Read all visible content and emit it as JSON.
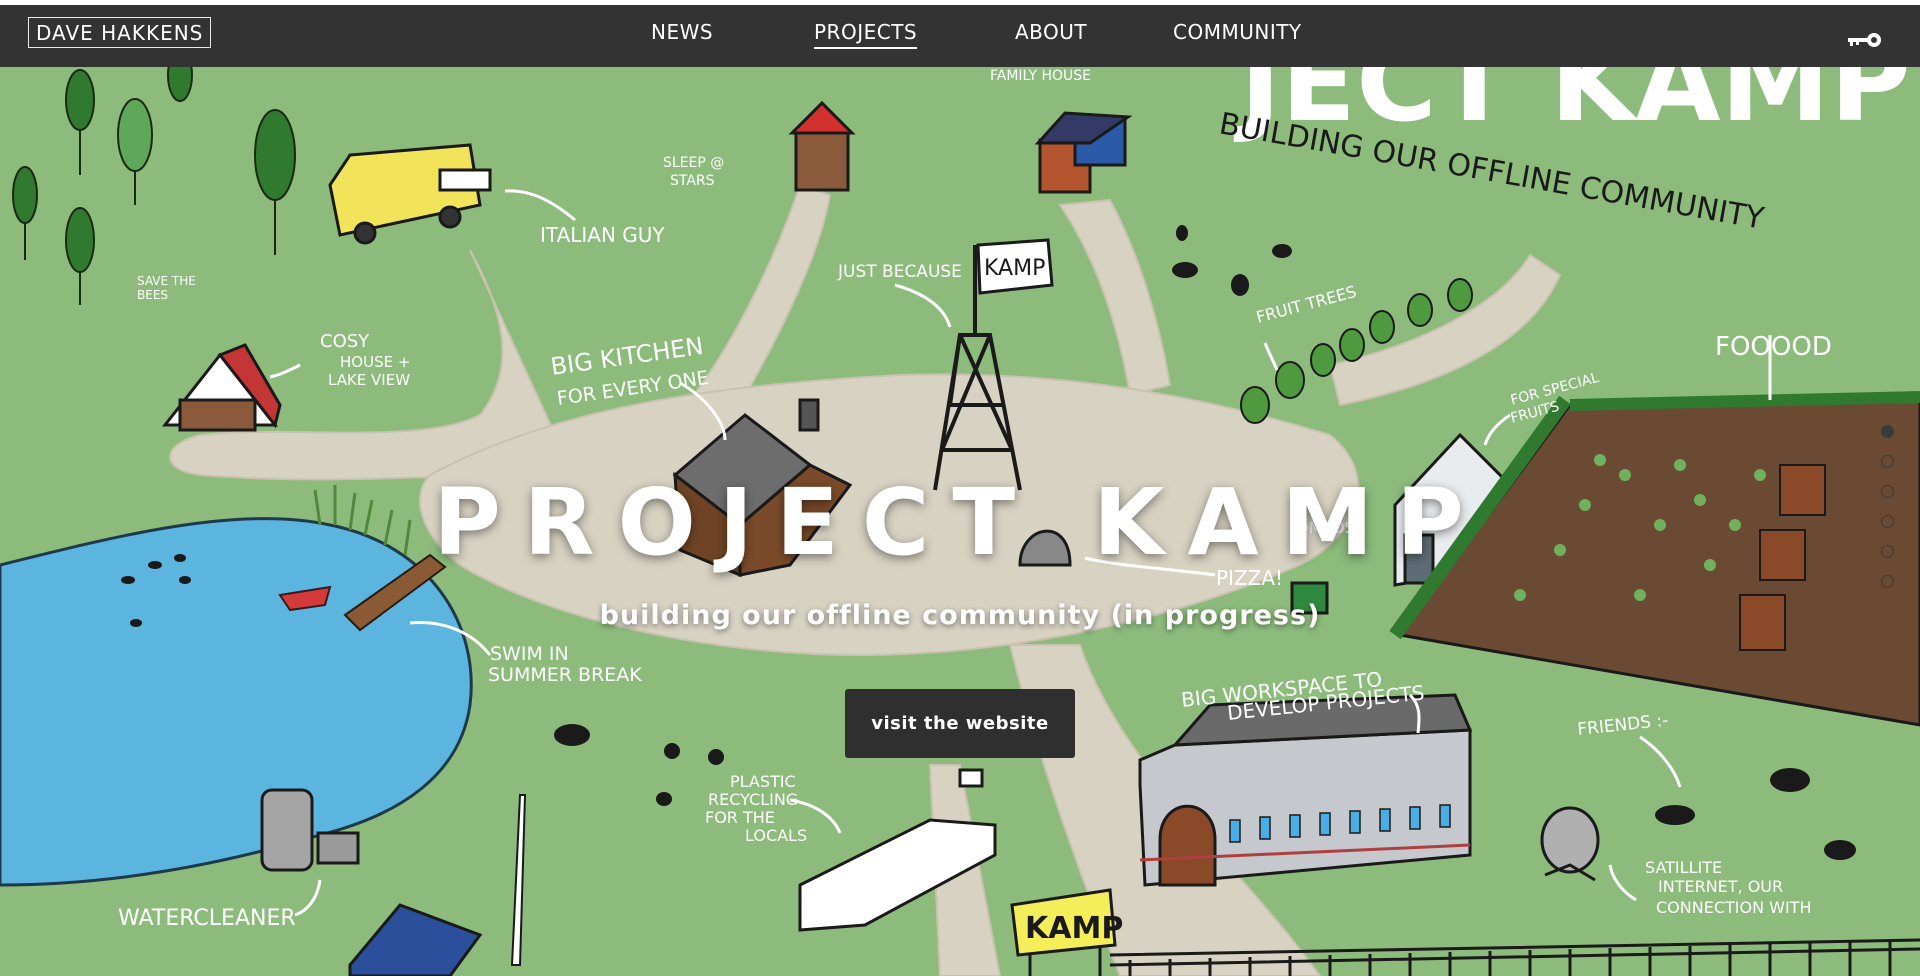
{
  "nav": {
    "logo": "DAVE HAKKENS",
    "links": [
      "NEWS",
      "PROJECTS",
      "ABOUT",
      "COMMUNITY"
    ],
    "active_link": "PROJECTS",
    "login_icon": "key-icon"
  },
  "hero": {
    "title": "PROJECT KAMP",
    "subtitle": "building our offline community (in progress)",
    "button_label": "visit the website",
    "slides_total": 6,
    "active_slide": 1
  },
  "map_labels": {
    "heading_big": "JECT KAMP",
    "heading_sub": "BUILDING OUR OFFLINE COMMUNITY",
    "italian_guy": "ITALIAN GUY",
    "sleep": "SLEEP @",
    "stars": "STARS",
    "family_house": "FAMILY HOUSE",
    "save_the": "SAVE THE",
    "bees": "BEES",
    "cosy": "COSY",
    "house": "HOUSE +",
    "lake_view": "LAKE VIEW",
    "just_because": "JUST BECAUSE",
    "kamp_flag": "KAMP",
    "big_kitchen": "BIG KITCHEN",
    "for_every_one": "FOR EVERY ONE",
    "fruit_trees": "FRUIT TREES",
    "foood": "FOOOOD",
    "for_special": "FOR SPECIAL",
    "fruits": "FRUITS",
    "compost": "OMPOST",
    "pizza": "PIZZA!",
    "swim_in": "SWIM IN",
    "summer_break": "SUMMER BREAK",
    "big_workspace": "BIG WORKSPACE TO",
    "develop_projects": "DEVELOP PROJECTS",
    "friends": "FRIENDS :-",
    "plastic": "PLASTIC",
    "recycling": "RECYCLING",
    "for_the": "FOR THE",
    "locals": "LOCALS",
    "satellite": "SATILLITE",
    "internet_our": "INTERNET, OUR",
    "connection_with": "CONNECTION WITH",
    "watercleaner": "WATERCLEANER",
    "kamp_sign": "KAMP"
  },
  "colors": {
    "nav_bg": "#333333",
    "grass": "#8cbb7c",
    "path": "#d8d2c2",
    "lake": "#5cb5df",
    "soil": "#6a4a33",
    "button_bg": "#2f2f2f"
  }
}
